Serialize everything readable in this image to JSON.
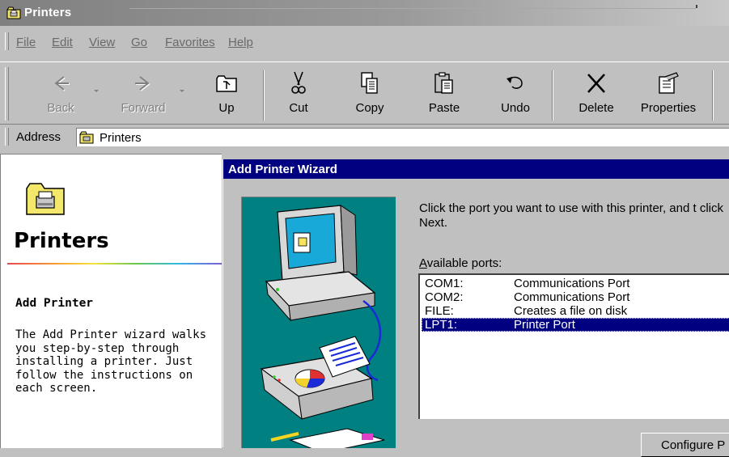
{
  "window": {
    "title": "Printers",
    "icon": "printer-folder-icon"
  },
  "menu": [
    "File",
    "Edit",
    "View",
    "Go",
    "Favorites",
    "Help"
  ],
  "toolbar": {
    "back": "Back",
    "forward": "Forward",
    "up": "Up",
    "cut": "Cut",
    "copy": "Copy",
    "paste": "Paste",
    "undo": "Undo",
    "delete": "Delete",
    "properties": "Properties"
  },
  "address": {
    "label": "Address",
    "value": "Printers"
  },
  "left_panel": {
    "title": "Printers",
    "subtitle": "Add Printer",
    "description": "The Add Printer wizard walks you step-by-step through installing a printer. Just follow the instructions on each screen."
  },
  "wizard": {
    "title": "Add Printer Wizard",
    "instruction": "Click the port you want to use with this printer, and t click Next.",
    "ports_label": "Available ports:",
    "ports": [
      {
        "name": "COM1:",
        "desc": "Communications Port"
      },
      {
        "name": "COM2:",
        "desc": "Communications Port"
      },
      {
        "name": "FILE:",
        "desc": "Creates a file on disk"
      },
      {
        "name": "LPT1:",
        "desc": "Printer Port"
      }
    ],
    "selected_port": "LPT1:",
    "configure_button": "Configure P"
  },
  "colors": {
    "title_bar": "#808080",
    "wizard_title_bar": "#000080",
    "selection": "#000080",
    "wizard_art_bg": "#008080",
    "face": "#c0c0c0"
  }
}
